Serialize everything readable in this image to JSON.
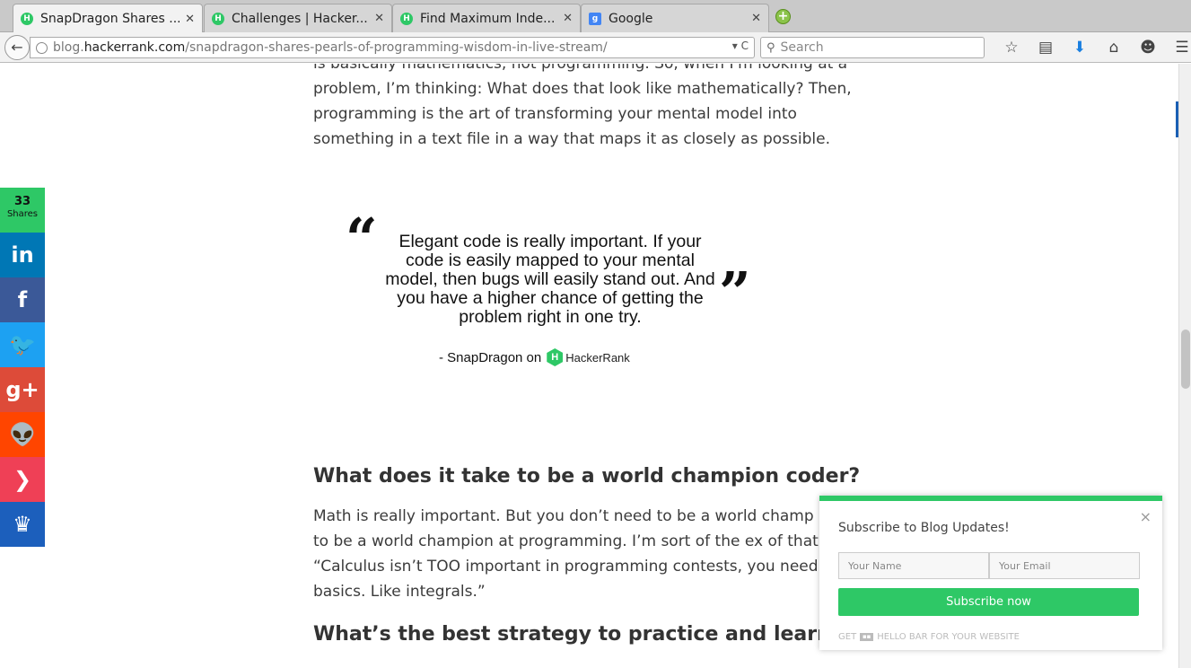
{
  "tabs": [
    {
      "title": "SnapDragon Shares ...",
      "favicon": "hackerrank-icon",
      "active": true
    },
    {
      "title": "Challenges | Hacker...",
      "favicon": "hackerrank-icon",
      "active": false
    },
    {
      "title": "Find Maximum Inde...",
      "favicon": "hackerrank-icon",
      "active": false
    },
    {
      "title": "Google",
      "favicon": "google-icon",
      "active": false
    }
  ],
  "tab_close": "✕",
  "newtab_label": "+",
  "navbar": {
    "url_prefix": "blog.",
    "url_host": "hackerrank.com",
    "url_path": "/snapdragon-shares-pearls-of-programming-wisdom-in-live-stream/",
    "url_controls": "▾ C",
    "search_placeholder": "Search"
  },
  "article": {
    "top_paragraph": "is basically mathematics, not programming. So, when I'm looking at a problem, I’m thinking: What does that look like mathematically? Then, programming is the art of transforming your mental model into something in a text file in a way that maps it as closely as possible.",
    "quote_text": "Elegant code is really important. If your code is easily mapped to your mental model, then bugs will easily stand out. And you have a higher chance of getting the problem right in one try.",
    "quote_attribution": "- SnapDragon on",
    "quote_brand": "HackerRank",
    "heading_champion": "What does it take to be a world champion coder?",
    "math_paragraph": "Math is really important. But you don’t need to be a world champ math to be a world champion at programming. I’m sort of the ex of that. “Calculus isn’t TOO important in programming contests, you need the basics. Like integrals.”",
    "heading_strategy": "What’s the best strategy to practice and learn?"
  },
  "share": {
    "count": "33",
    "count_label": "Shares",
    "buttons": [
      {
        "name": "linkedin",
        "glyph": "in",
        "color": "#0077b5"
      },
      {
        "name": "facebook",
        "glyph": "f",
        "color": "#3b5998"
      },
      {
        "name": "twitter",
        "glyph": "🐦",
        "color": "#1da1f2"
      },
      {
        "name": "google-plus",
        "glyph": "g+",
        "color": "#dd4b39"
      },
      {
        "name": "reddit",
        "glyph": "👽",
        "color": "#ff4500"
      },
      {
        "name": "pocket",
        "glyph": "❯",
        "color": "#ef4056"
      },
      {
        "name": "sumome",
        "glyph": "♛",
        "color": "#1c5fbc"
      }
    ]
  },
  "popup": {
    "title": "Subscribe to Blog Updates!",
    "close": "×",
    "name_placeholder": "Your Name",
    "email_placeholder": "Your Email",
    "submit_label": "Subscribe now",
    "footer_prefix": "GET",
    "footer_suffix": "HELLO BAR FOR YOUR WEBSITE"
  },
  "colors": {
    "hackerrank_green": "#2ec866",
    "accent_blue": "#1a7fe0"
  }
}
